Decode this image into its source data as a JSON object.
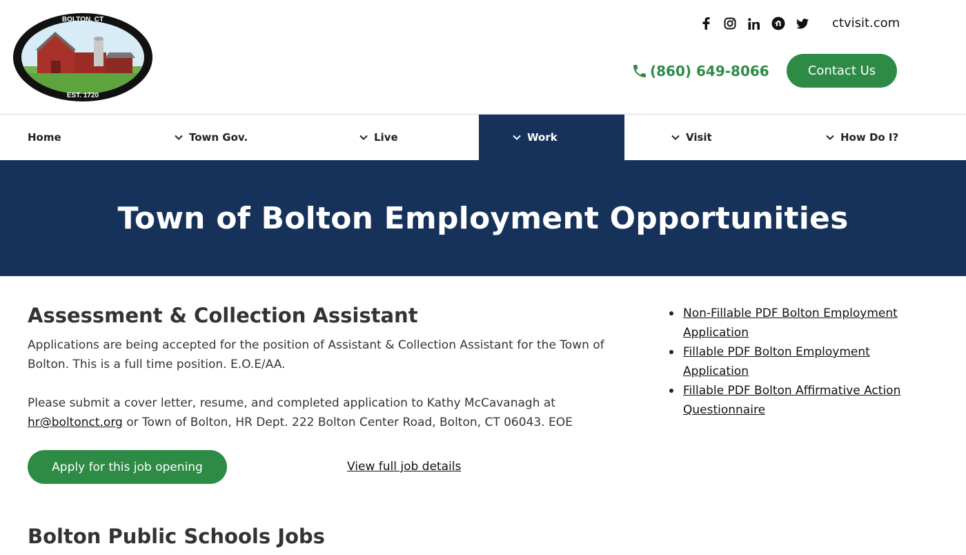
{
  "header": {
    "logo": {
      "top_text": "BOLTON, CT",
      "bottom_text": "EST. 1720"
    },
    "social": [
      {
        "name": "facebook-icon",
        "glyph": "f"
      },
      {
        "name": "instagram-icon",
        "glyph": "ig"
      },
      {
        "name": "linkedin-icon",
        "glyph": "in"
      },
      {
        "name": "nextdoor-icon",
        "glyph": "n"
      },
      {
        "name": "twitter-icon",
        "glyph": "t"
      }
    ],
    "ctvisit": "ctvisit.com",
    "phone": "(860) 649-8066",
    "contact_label": "Contact Us",
    "accent_color": "#2e8b46"
  },
  "nav": {
    "items": [
      {
        "label": "Home",
        "has_chevron": false
      },
      {
        "label": "Town Gov.",
        "has_chevron": true
      },
      {
        "label": "Live",
        "has_chevron": true
      },
      {
        "label": "Work",
        "has_chevron": true,
        "active": true
      },
      {
        "label": "Visit",
        "has_chevron": true
      },
      {
        "label": "How Do I?",
        "has_chevron": true
      }
    ],
    "active_color": "#16325a"
  },
  "hero": {
    "title": "Town of Bolton Employment Opportunities"
  },
  "job": {
    "title": "Assessment & Collection Assistant",
    "para1": "Applications are being accepted for the position of Assistant & Collection Assistant for the Town of Bolton.  This is a full time position. E.O.E/AA.",
    "para2_prefix": "Please submit a cover letter, resume, and completed application to Kathy McCavanagh at ",
    "email": "hr@boltonct.org",
    "para2_suffix": " or Town of Bolton, HR Dept. 222 Bolton Center Road, Bolton, CT 06043. EOE",
    "apply_label": "Apply for this job opening",
    "details_label": "View full job details"
  },
  "sidebar": {
    "links": [
      "Non-Fillable PDF Bolton Employment Application",
      "Fillable PDF Bolton Employment Application",
      "Fillable PDF Bolton Affirmative Action Questionnaire"
    ]
  },
  "schools": {
    "title": "Bolton Public Schools Jobs"
  }
}
